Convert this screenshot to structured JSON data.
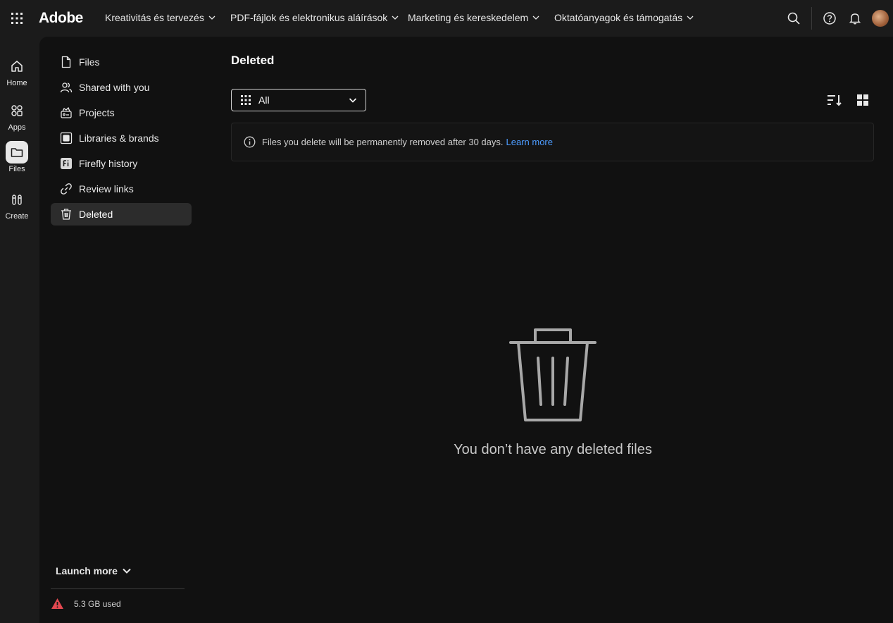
{
  "topbar": {
    "brand": "Adobe",
    "nav": [
      {
        "label": "Kreativitás és tervezés"
      },
      {
        "label": "PDF-fájlok és elektronikus aláírások"
      },
      {
        "label": "Marketing és kereskedelem"
      },
      {
        "label": "Oktatóanyagok és támogatás"
      }
    ],
    "icons": [
      "app-switcher-icon",
      "search-icon",
      "help-icon",
      "bell-icon",
      "avatar"
    ]
  },
  "rail": {
    "items": [
      {
        "label": "Home",
        "icon": "home-icon"
      },
      {
        "label": "Apps",
        "icon": "apps-icon"
      },
      {
        "label": "Files",
        "icon": "folder-icon",
        "active": true
      },
      {
        "label": "Create",
        "icon": "create-icon"
      }
    ]
  },
  "sidebar": {
    "items": [
      {
        "label": "Files",
        "icon": "file-icon"
      },
      {
        "label": "Shared with you",
        "icon": "users-icon"
      },
      {
        "label": "Projects",
        "icon": "projects-icon"
      },
      {
        "label": "Libraries & brands",
        "icon": "libraries-icon"
      },
      {
        "label": "Firefly history",
        "icon": "firefly-icon"
      },
      {
        "label": "Review links",
        "icon": "link-icon"
      },
      {
        "label": "Deleted",
        "icon": "trash-icon",
        "active": true
      }
    ],
    "launch_more": "Launch more",
    "storage": "5.3 GB used"
  },
  "main": {
    "title": "Deleted",
    "filter": {
      "selected": "All"
    },
    "notice": {
      "text": "Files you delete will be permanently removed after 30 days.",
      "link": "Learn more"
    },
    "empty_message": "You don’t have any deleted files"
  },
  "colors": {
    "background": "#111111",
    "chrome": "#1b1b1b",
    "link": "#4d9cff",
    "warning": "#e34850"
  }
}
